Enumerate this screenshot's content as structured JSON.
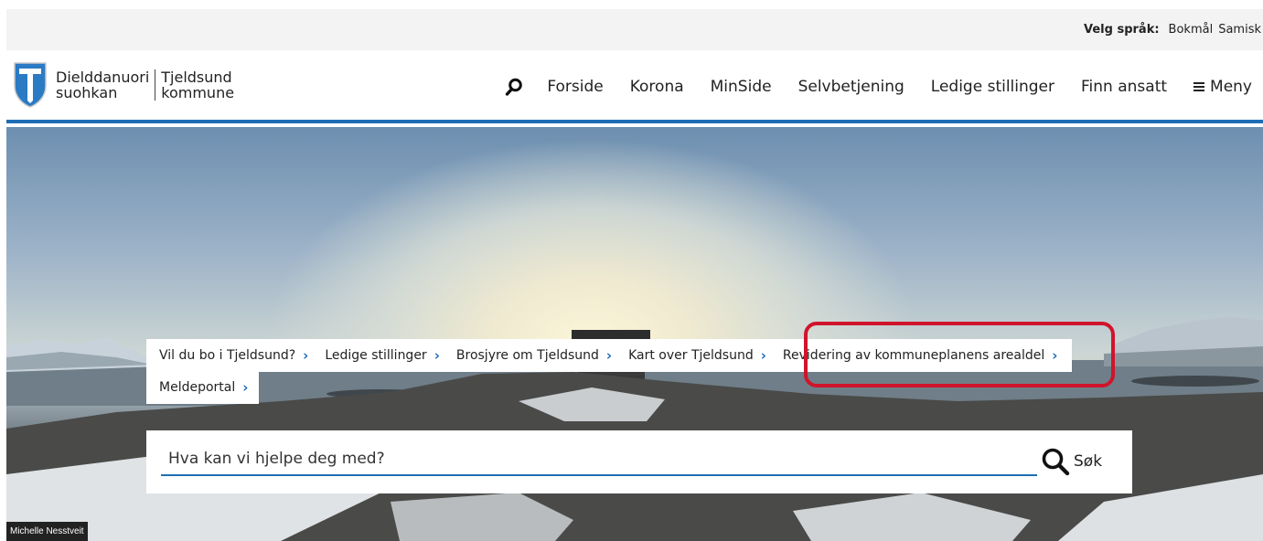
{
  "language_bar": {
    "label": "Velg språk:",
    "options": [
      "Bokmål",
      "Samisk"
    ]
  },
  "logo": {
    "line1_left": "Dielddanuori",
    "line2_left": "suohkan",
    "line1_right": "Tjeldsund",
    "line2_right": "kommune",
    "icon": "coat-of-arms-icon"
  },
  "nav": {
    "search_icon": "search-icon",
    "items": [
      "Forside",
      "Korona",
      "MinSide",
      "Selvbetjening",
      "Ledige stillinger",
      "Finn ansatt"
    ],
    "menu_label": "Meny"
  },
  "quick_links": {
    "row1": [
      "Vil du bo i Tjeldsund?",
      "Ledige stillinger",
      "Brosjyre om Tjeldsund",
      "Kart over Tjeldsund",
      "Revidering av kommuneplanens arealdel"
    ],
    "row2": [
      "Meldeportal"
    ]
  },
  "search": {
    "placeholder": "Hva kan vi hjelpe deg med?",
    "button_label": "Søk"
  },
  "photo_credit": "Michelle Nesstveit",
  "colors": {
    "accent_blue": "#1f6db5",
    "highlight_red": "#d0142c"
  }
}
